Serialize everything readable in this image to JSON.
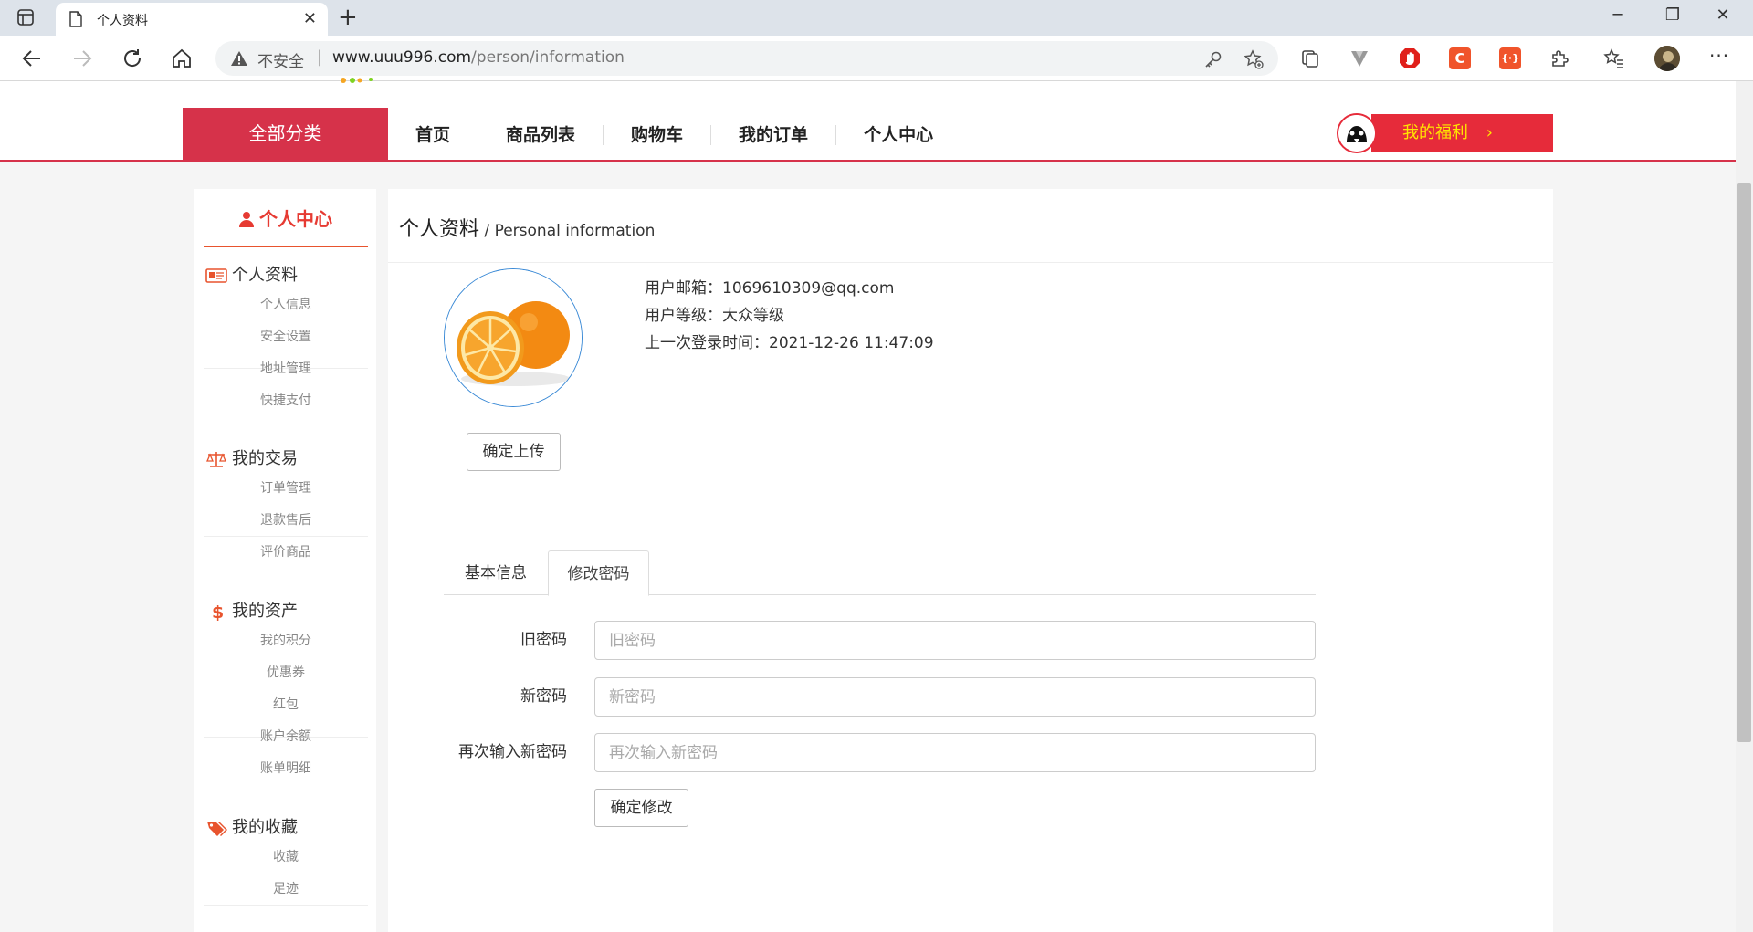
{
  "browser": {
    "tab_title": "个人资料",
    "new_tab_icon": "plus-icon",
    "address": {
      "security_label": "不安全",
      "url_host": "www.uuu996.com",
      "url_path": "/person/information"
    },
    "window_controls": [
      "minimize-icon",
      "restore-icon",
      "close-icon"
    ]
  },
  "header": {
    "all_categories": "全部分类",
    "nav": [
      {
        "label": "首页"
      },
      {
        "label": "商品列表"
      },
      {
        "label": "购物车"
      },
      {
        "label": "我的订单"
      },
      {
        "label": "个人中心"
      }
    ],
    "welfare_label": "我的福利",
    "welfare_arrow": "›"
  },
  "sidebar": {
    "title": "个人中心",
    "groups": [
      {
        "title": "个人资料",
        "icon": "id-card-icon",
        "items": [
          "个人信息",
          "安全设置",
          "地址管理",
          "快捷支付"
        ]
      },
      {
        "title": "我的交易",
        "icon": "scales-icon",
        "items": [
          "订单管理",
          "退款售后",
          "评价商品"
        ]
      },
      {
        "title": "我的资产",
        "icon": "dollar-icon",
        "items": [
          "我的积分",
          "优惠券",
          "红包",
          "账户余额",
          "账单明细"
        ]
      },
      {
        "title": "我的收藏",
        "icon": "tags-icon",
        "items": [
          "收藏",
          "足迹"
        ]
      }
    ]
  },
  "main": {
    "title": "个人资料",
    "title_sep": " / ",
    "title_en": "Personal information",
    "upload_button": "确定上传",
    "info": [
      {
        "label": "用户邮箱：",
        "value": "1069610309@qq.com"
      },
      {
        "label": "用户等级：",
        "value": "大众等级"
      },
      {
        "label": "上一次登录时间：",
        "value": "2021-12-26 11:47:09"
      }
    ],
    "tabs": [
      {
        "label": "基本信息",
        "active": false
      },
      {
        "label": "修改密码",
        "active": true
      }
    ],
    "form": {
      "old_password": {
        "label": "旧密码",
        "placeholder": "旧密码"
      },
      "new_password": {
        "label": "新密码",
        "placeholder": "新密码"
      },
      "confirm_password": {
        "label": "再次输入新密码",
        "placeholder": "再次输入新密码"
      },
      "submit": "确定修改"
    }
  },
  "colors": {
    "brand_red": "#d6324a",
    "welfare_red": "#e62b3a",
    "welfare_text": "#ffe500",
    "sidebar_accent": "#e63a32"
  }
}
